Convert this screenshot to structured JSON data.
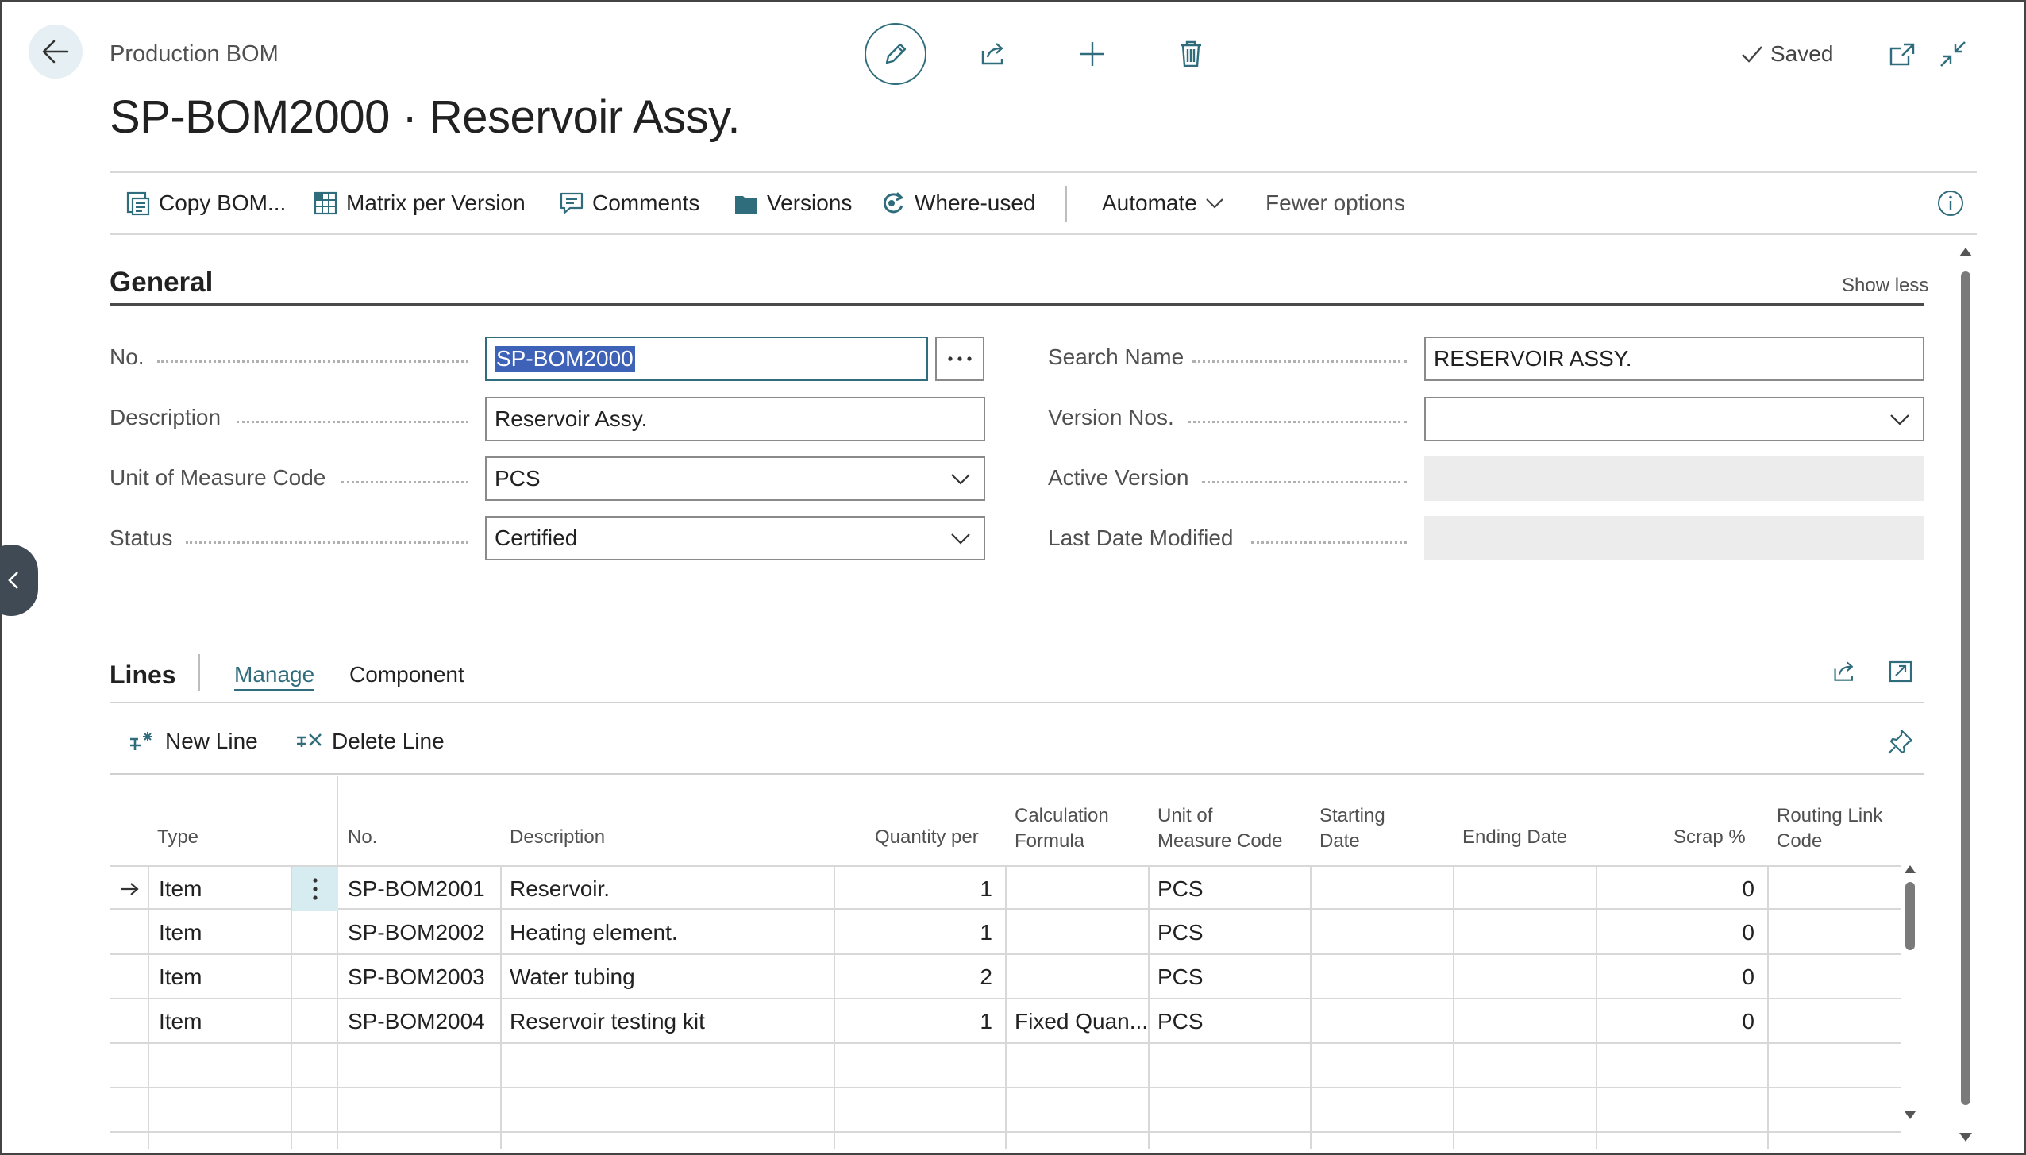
{
  "header": {
    "page_caption": "Production BOM",
    "record_title": "SP-BOM2000 · Reservoir Assy.",
    "saved_label": "Saved"
  },
  "actionbar": {
    "items": [
      {
        "label": "Copy BOM...",
        "icon": "copy-bom-icon"
      },
      {
        "label": "Matrix per Version",
        "icon": "matrix-icon"
      },
      {
        "label": "Comments",
        "icon": "comment-icon"
      },
      {
        "label": "Versions",
        "icon": "folder-icon"
      },
      {
        "label": "Where-used",
        "icon": "where-used-icon"
      }
    ],
    "automate_label": "Automate",
    "fewer_options_label": "Fewer options"
  },
  "general": {
    "title": "General",
    "show_less": "Show less",
    "no_label": "No.",
    "no_value": "SP-BOM2000",
    "description_label": "Description",
    "description_value": "Reservoir Assy.",
    "uom_label": "Unit of Measure Code",
    "uom_value": "PCS",
    "status_label": "Status",
    "status_value": "Certified",
    "search_name_label": "Search Name",
    "search_name_value": "RESERVOIR ASSY.",
    "version_nos_label": "Version Nos.",
    "version_nos_value": "",
    "active_version_label": "Active Version",
    "active_version_value": "",
    "last_modified_label": "Last Date Modified",
    "last_modified_value": ""
  },
  "lines": {
    "title": "Lines",
    "tab_manage": "Manage",
    "tab_component": "Component",
    "new_line": "New Line",
    "delete_line": "Delete Line",
    "columns": {
      "type": "Type",
      "no": "No.",
      "description": "Description",
      "qty_per": "Quantity per",
      "calc_formula_1": "Calculation",
      "calc_formula_2": "Formula",
      "uom_1": "Unit of",
      "uom_2": "Measure Code",
      "start_1": "Starting",
      "start_2": "Date",
      "ending": "Ending Date",
      "scrap": "Scrap %",
      "routing_1": "Routing Link",
      "routing_2": "Code"
    },
    "rows": [
      {
        "type": "Item",
        "no": "SP-BOM2001",
        "description": "Reservoir.",
        "qty": "1",
        "formula": "",
        "uom": "PCS",
        "scrap": "0"
      },
      {
        "type": "Item",
        "no": "SP-BOM2002",
        "description": "Heating element.",
        "qty": "1",
        "formula": "",
        "uom": "PCS",
        "scrap": "0"
      },
      {
        "type": "Item",
        "no": "SP-BOM2003",
        "description": "Water tubing",
        "qty": "2",
        "formula": "",
        "uom": "PCS",
        "scrap": "0"
      },
      {
        "type": "Item",
        "no": "SP-BOM2004",
        "description": "Reservoir testing kit",
        "qty": "1",
        "formula": "Fixed Quan...",
        "uom": "PCS",
        "scrap": "0"
      }
    ]
  },
  "colors": {
    "accent": "#2f6d7d",
    "selection": "#3d62b7",
    "readonly_bg": "#ececec"
  }
}
